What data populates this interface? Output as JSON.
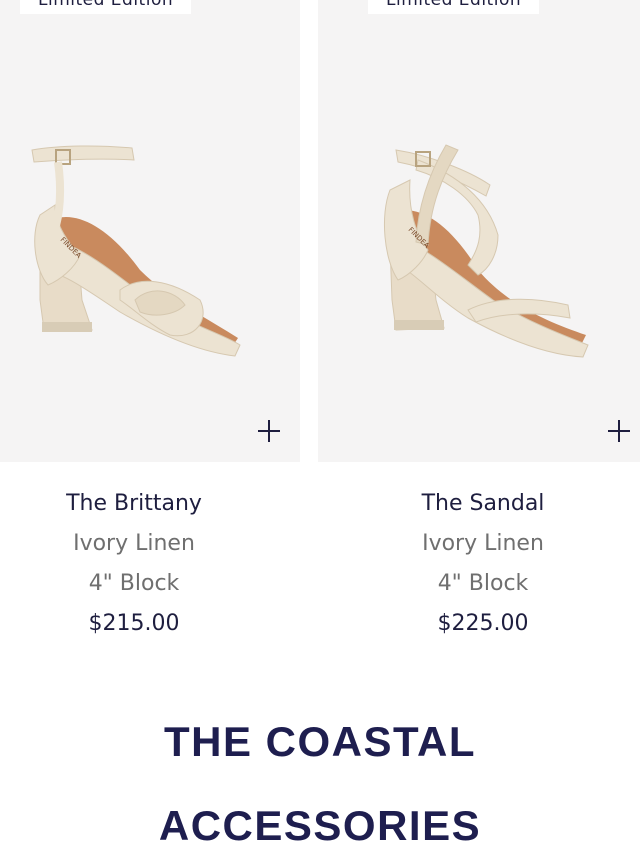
{
  "products": [
    {
      "badge": "Limited Edition",
      "name": "The Brittany",
      "material": "Ivory Linen",
      "heel": "4\" Block",
      "price": "$215.00"
    },
    {
      "badge": "Limited Edition",
      "name": "The Sandal",
      "material": "Ivory Linen",
      "heel": "4\" Block",
      "price": "$225.00"
    }
  ],
  "section": {
    "heading_line1": "THE COASTAL",
    "heading_line2": "ACCESSORIES"
  },
  "colors": {
    "navy": "#1e1e3f",
    "gray_text": "#6f6f6f",
    "tile_bg": "#f5f4f4",
    "shoe_ivory": "#ece3d2",
    "shoe_tan": "#c98a5e"
  },
  "icons": {
    "add": "plus-icon"
  }
}
